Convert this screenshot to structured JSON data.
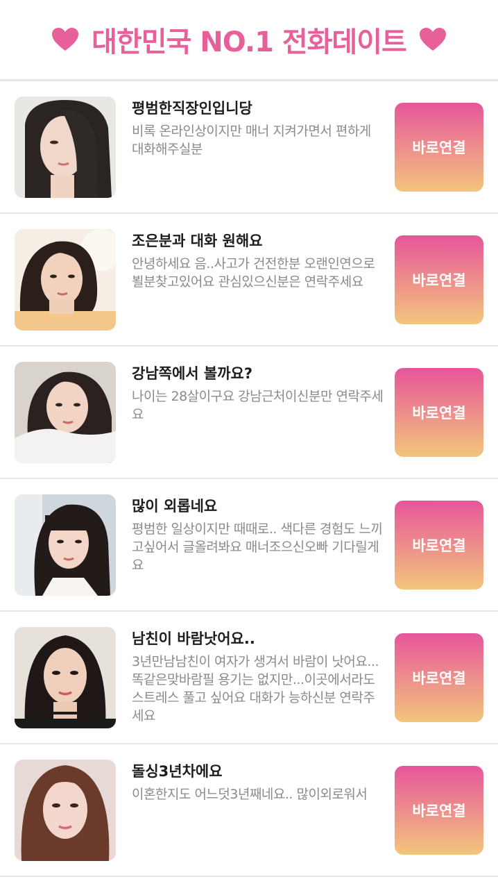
{
  "header": {
    "title": "대한민국 NO.1 전화데이트"
  },
  "colors": {
    "accent": "#e8609a",
    "button_top": "#e6569a",
    "button_bottom": "#f3c57c"
  },
  "profiles": [
    {
      "name": "평범한직장인입니당",
      "desc": "비록 온라인상이지만 매너 지켜가면서 편하게 대화해주실분",
      "button": "바로연결"
    },
    {
      "name": "조은분과 대화 원해요",
      "desc": "안녕하세요 음..사고가 건전한분 오랜인연으로 뵐분찾고있어요 관심있으신분은 연락주세요",
      "button": "바로연결"
    },
    {
      "name": "강남쪽에서 볼까요?",
      "desc": "나이는 28살이구요 강남근처이신분만 연락주세요",
      "button": "바로연결"
    },
    {
      "name": "많이 외롭네요",
      "desc": "평범한 일상이지만 때때로.. 색다른 경험도 느끼고싶어서 글올려봐요 매너조으신오빠 기다릴게요",
      "button": "바로연결"
    },
    {
      "name": "남친이 바람낫어요..",
      "desc": "3년만남남친이 여자가 생겨서 바람이 낫어요... 똑같은맞바람필 용기는 없지만...이곳에서라도 스트레스 풀고 싶어요 대화가 능하신분 연락주세요",
      "button": "바로연결"
    },
    {
      "name": "돌싱3년차에요",
      "desc": "이혼한지도 어느덧3년째네요.. 많이외로워서",
      "button": "바로연결"
    }
  ]
}
